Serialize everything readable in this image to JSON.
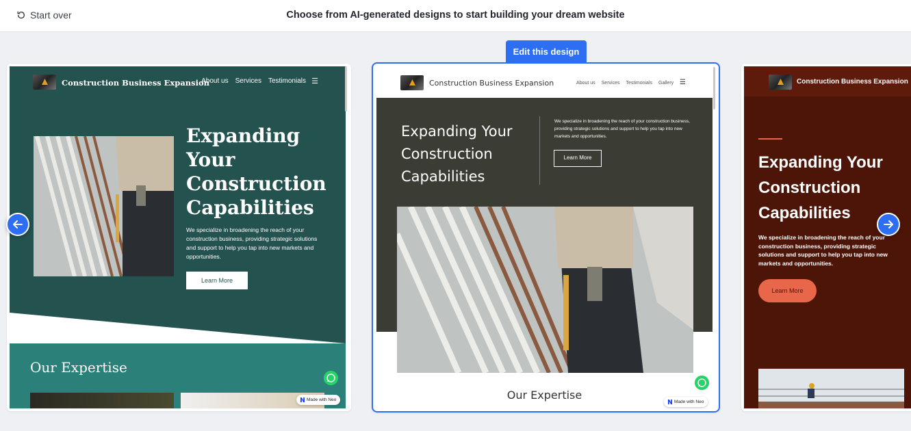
{
  "topbar": {
    "start_over": "Start over",
    "title": "Choose from AI-generated designs to start building your dream website"
  },
  "edit_button": "Edit this design",
  "designs": {
    "left": {
      "brand": "Construction Business Expansion",
      "nav": [
        "About us",
        "Services",
        "Testimonials"
      ],
      "headline": "Expanding Your Construction Capabilities",
      "body": "We specialize in broadening the reach of your construction business, providing strategic solutions and support to help you tap into new markets and opportunities.",
      "cta": "Learn More",
      "section_title": "Our Expertise",
      "made_with": "Made with Neo",
      "colors": {
        "hero": "#24524f",
        "section": "#2c807a"
      }
    },
    "middle": {
      "brand": "Construction Business Expansion",
      "nav": [
        "About us",
        "Services",
        "Testimonials",
        "Gallery"
      ],
      "headline": "Expanding Your Construction Capabilities",
      "body": "We specialize in broadening the reach of your construction business, providing strategic solutions and support to help you tap into new markets and opportunities.",
      "cta": "Learn More",
      "section_title": "Our Expertise",
      "made_with": "Made with Neo",
      "colors": {
        "hero": "#3b3c33"
      }
    },
    "right": {
      "brand": "Construction Business Expansion",
      "headline": "Expanding Your Construction Capabilities",
      "body": "We specialize in broadening the reach of your construction business, providing strategic solutions and support to help you tap into new markets and opportunities.",
      "cta": "Learn More",
      "colors": {
        "bg": "#4d1508",
        "accent": "#e8664a"
      }
    }
  },
  "colors": {
    "accent": "#2d6ef2"
  },
  "icons": {
    "start_over": "refresh-icon",
    "prev": "arrow-left-icon",
    "next": "arrow-right-icon",
    "whatsapp": "whatsapp-icon",
    "menu": "hamburger-menu-icon"
  }
}
